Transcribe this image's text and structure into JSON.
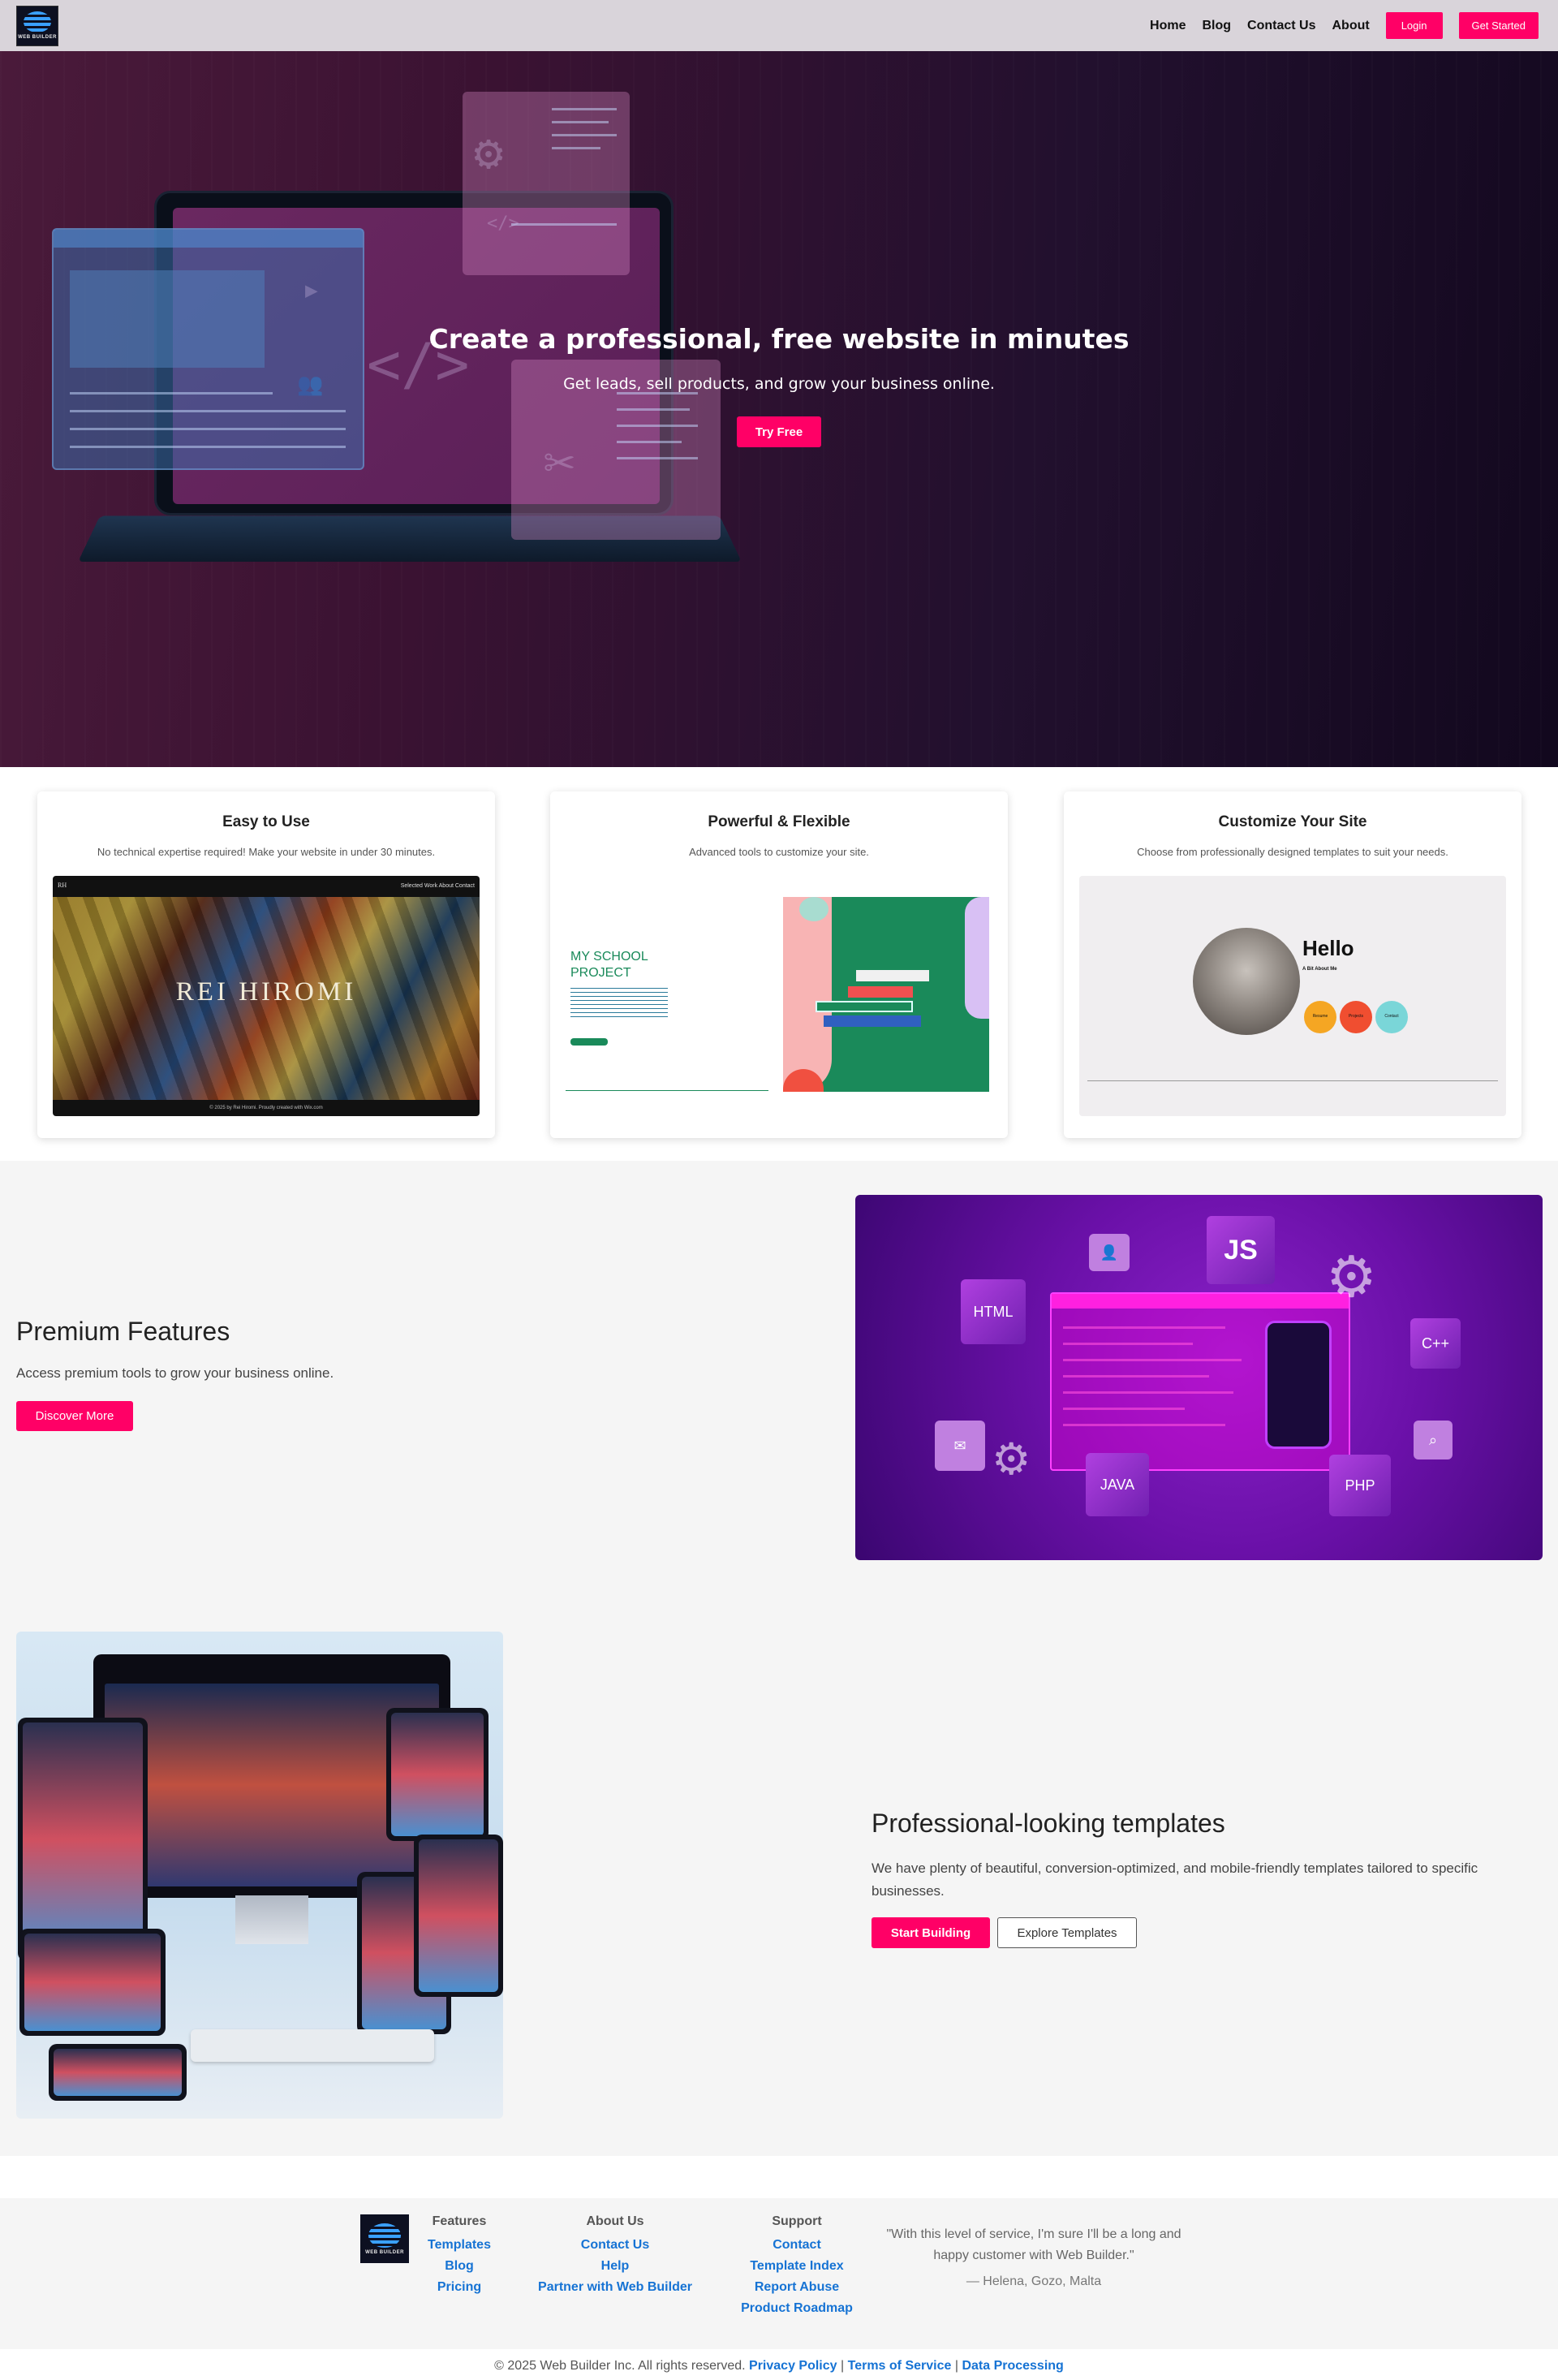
{
  "nav": {
    "logo_text": "WEB BUILDER",
    "links": [
      "Home",
      "Blog",
      "Contact Us",
      "About"
    ],
    "login_label": "Login",
    "get_started_label": "Get Started"
  },
  "hero": {
    "title": "Create a professional, free website in minutes",
    "subtitle": "Get leads, sell products, and grow your business online.",
    "cta_label": "Try Free"
  },
  "cards": [
    {
      "title": "Easy to Use",
      "description": "No technical expertise required! Make your website in under 30 minutes.",
      "preview": {
        "brand": "RH",
        "menu": "Selected Work   About   Contact",
        "name": "REI HIROMI",
        "footer": "© 2025 by Rei Hiromi. Proudly created with Wix.com"
      }
    },
    {
      "title": "Powerful & Flexible",
      "description": "Advanced tools to customize your site.",
      "preview": {
        "heading_line1": "MY SCHOOL",
        "heading_line2": "PROJECT"
      }
    },
    {
      "title": "Customize Your Site",
      "description": "Choose from professionally designed templates to suit your needs.",
      "preview": {
        "greeting": "Hello",
        "subheading": "A Bit About Me",
        "buttons": [
          "Resume",
          "Projects",
          "Contact"
        ]
      }
    }
  ],
  "premium": {
    "title": "Premium Features",
    "subtitle": "Access premium tools to grow your business online.",
    "cta_label": "Discover More",
    "tiles": [
      "JS",
      "HTML",
      "C++",
      "JAVA",
      "PHP"
    ]
  },
  "templates": {
    "title": "Professional-looking templates",
    "subtitle": "We have plenty of beautiful, conversion-optimized, and mobile-friendly templates tailored to specific businesses.",
    "primary_label": "Start Building",
    "secondary_label": "Explore Templates"
  },
  "footer": {
    "columns": [
      {
        "heading": "Features",
        "links": [
          "Templates",
          "Blog",
          "Pricing"
        ]
      },
      {
        "heading": "About Us",
        "links": [
          "Contact Us",
          "Help",
          "Partner with Web Builder"
        ]
      },
      {
        "heading": "Support",
        "links": [
          "Contact",
          "Template Index",
          "Report Abuse",
          "Product Roadmap"
        ]
      }
    ],
    "quote": "\"With this level of service, I'm sure I'll be a long and happy customer with Web Builder.\"",
    "quote_author": "— Helena, Gozo, Malta",
    "copyright": "© 2025 Web Builder Inc. All rights reserved.",
    "legal_links": [
      "Privacy Policy",
      "Terms of Service",
      "Data Processing"
    ],
    "separator": "|"
  },
  "colors": {
    "accent": "#ff0066",
    "link": "#1673d4",
    "nav_bg": "#d9d4da"
  }
}
